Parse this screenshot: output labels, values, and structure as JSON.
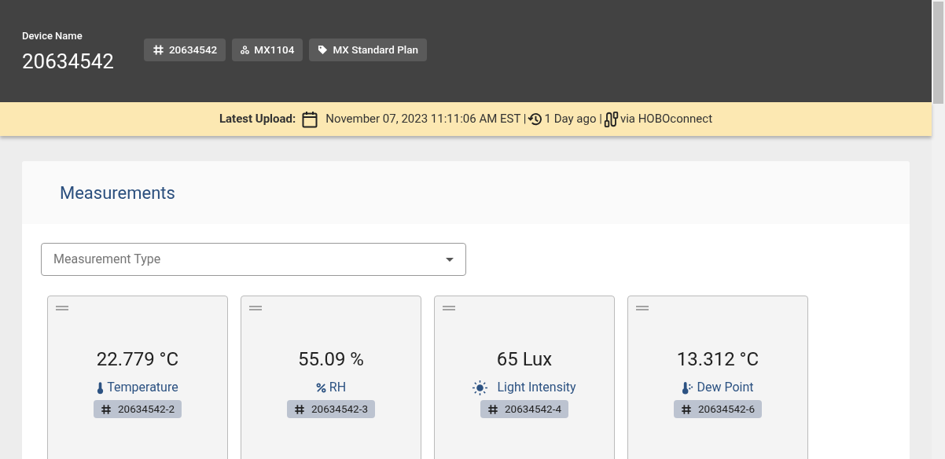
{
  "header": {
    "label": "Device Name",
    "device_name": "20634542",
    "tags": [
      {
        "kind": "serial",
        "text": "20634542"
      },
      {
        "kind": "model",
        "text": "MX1104"
      },
      {
        "kind": "plan",
        "text": "MX Standard Plan"
      }
    ]
  },
  "upload_banner": {
    "label": "Latest Upload:",
    "date": "November 07, 2023 11:11:06 AM EST |",
    "ago": "1 Day ago |",
    "via": "via HOBOconnect"
  },
  "measurements": {
    "title": "Measurements",
    "select": {
      "placeholder": "Measurement Type"
    },
    "tiles": [
      {
        "kind": "temperature",
        "value": "22.779 °C",
        "name": "Temperature",
        "channel": "20634542-2"
      },
      {
        "kind": "rh",
        "value": "55.09 %",
        "name": "RH",
        "channel": "20634542-3"
      },
      {
        "kind": "light",
        "value": "65 Lux",
        "name": "Light Intensity",
        "channel": "20634542-4"
      },
      {
        "kind": "dewpoint",
        "value": "13.312 °C",
        "name": "Dew Point",
        "channel": "20634542-6"
      }
    ]
  }
}
